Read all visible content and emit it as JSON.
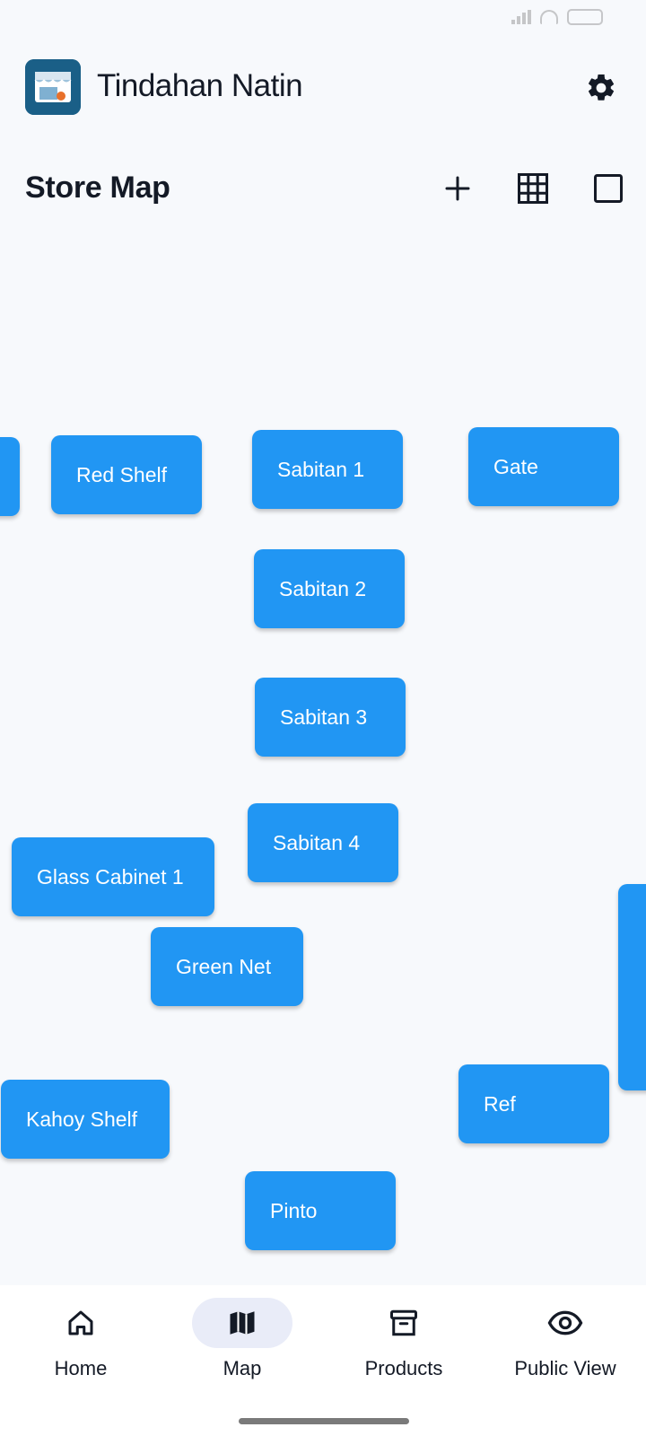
{
  "app": {
    "title": "Tindahan Natin"
  },
  "toolbar": {
    "title": "Store Map",
    "add_icon": "plus-icon",
    "grid_icon": "grid-icon",
    "square_icon": "square-icon"
  },
  "map": {
    "nodes": [
      {
        "label": ""
      },
      {
        "label": "Red Shelf"
      },
      {
        "label": "Sabitan 1"
      },
      {
        "label": "Gate"
      },
      {
        "label": "Sabitan 2"
      },
      {
        "label": "Sabitan 3"
      },
      {
        "label": "Sabitan 4"
      },
      {
        "label": "Glass Cabinet 1"
      },
      {
        "label": "Green Net"
      },
      {
        "label": ""
      },
      {
        "label": "Kahoy Shelf"
      },
      {
        "label": "Ref"
      },
      {
        "label": "Pinto"
      }
    ],
    "node_color": "#2196f3"
  },
  "nav": {
    "items": [
      {
        "label": "Home",
        "icon": "home-icon"
      },
      {
        "label": "Map",
        "icon": "map-icon",
        "active": true
      },
      {
        "label": "Products",
        "icon": "archive-icon"
      },
      {
        "label": "Public View",
        "icon": "eye-icon"
      }
    ]
  },
  "colors": {
    "background": "#f7f9fc",
    "accent": "#2196f3",
    "text": "#141a26",
    "nav_active_pill": "#e9ecf8"
  }
}
